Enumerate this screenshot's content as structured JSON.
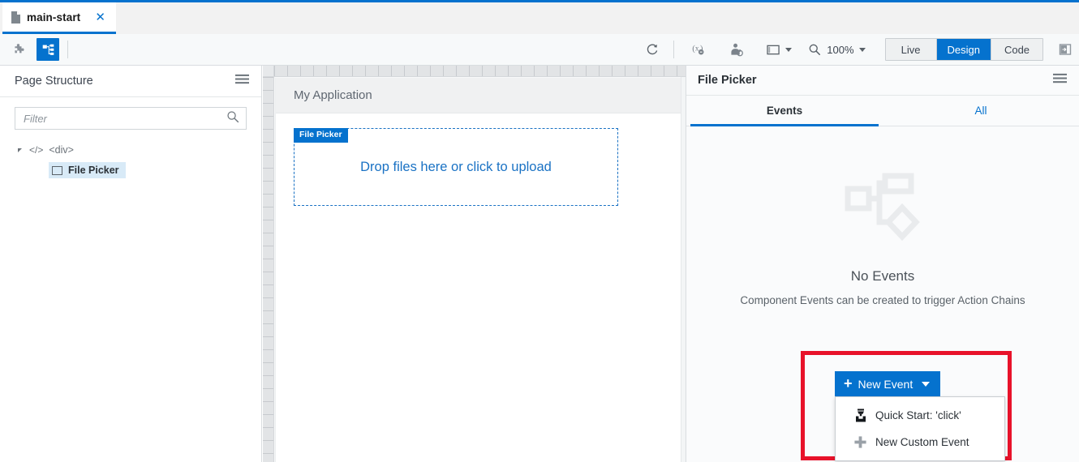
{
  "window": {
    "tab": {
      "label": "main-start",
      "file_icon": "file-icon",
      "close_icon": "close-icon"
    }
  },
  "toolbar": {
    "left_buttons": [
      {
        "name": "components-palette-icon",
        "label": "Components",
        "active": false
      },
      {
        "name": "page-structure-icon",
        "label": "Page Structure",
        "active": true
      }
    ],
    "refresh_icon": "refresh-icon",
    "variables_icon": "variables-icon",
    "user-assignment_icon": "user-assignment-icon",
    "device_icon": "device-preview-icon",
    "zoom": {
      "icon": "magnifier-icon",
      "value": "100%"
    },
    "modes": [
      {
        "label": "Live",
        "selected": false
      },
      {
        "label": "Design",
        "selected": true
      },
      {
        "label": "Code",
        "selected": false
      }
    ],
    "panel_toggle_icon": "toggle-right-panel-icon",
    "accent_color": "#0572ce"
  },
  "left_panel": {
    "title": "Page Structure",
    "menu_icon": "hamburger-menu-icon",
    "filter": {
      "placeholder": "Filter",
      "value": "",
      "search_icon": "search-icon"
    },
    "tree": {
      "root": {
        "tag_icon": "code-tag-icon",
        "tag": "<div>",
        "expander": "expanded-arrow-icon"
      },
      "child": {
        "icon": "component-box-icon",
        "label": "File Picker",
        "selected": true,
        "selection_color": "#d8eaf7"
      }
    }
  },
  "canvas": {
    "app_title": "My Application",
    "component": {
      "badge": "File Picker",
      "badge_color": "#0572ce",
      "dropzone_text": "Drop files here or click to upload",
      "dropzone_border_color": "#1a72c4"
    }
  },
  "right_panel": {
    "title": "File Picker",
    "menu_icon": "hamburger-menu-icon",
    "tabs": [
      {
        "label": "Events",
        "selected": true
      },
      {
        "label": "All",
        "selected": false
      }
    ],
    "empty_state": {
      "icon": "event-flow-icon",
      "title": "No Events",
      "subtitle": "Component Events can be created to trigger Action Chains"
    },
    "new_event": {
      "button_label": "New Event",
      "plus_icon": "plus-icon",
      "caret_icon": "chevron-down-icon",
      "menu_items": [
        {
          "label": "Quick Start: 'click'",
          "icon": "click-event-icon"
        },
        {
          "label": "New Custom Event",
          "icon": "plus-icon"
        }
      ]
    },
    "highlight_color": "#e8122a"
  }
}
